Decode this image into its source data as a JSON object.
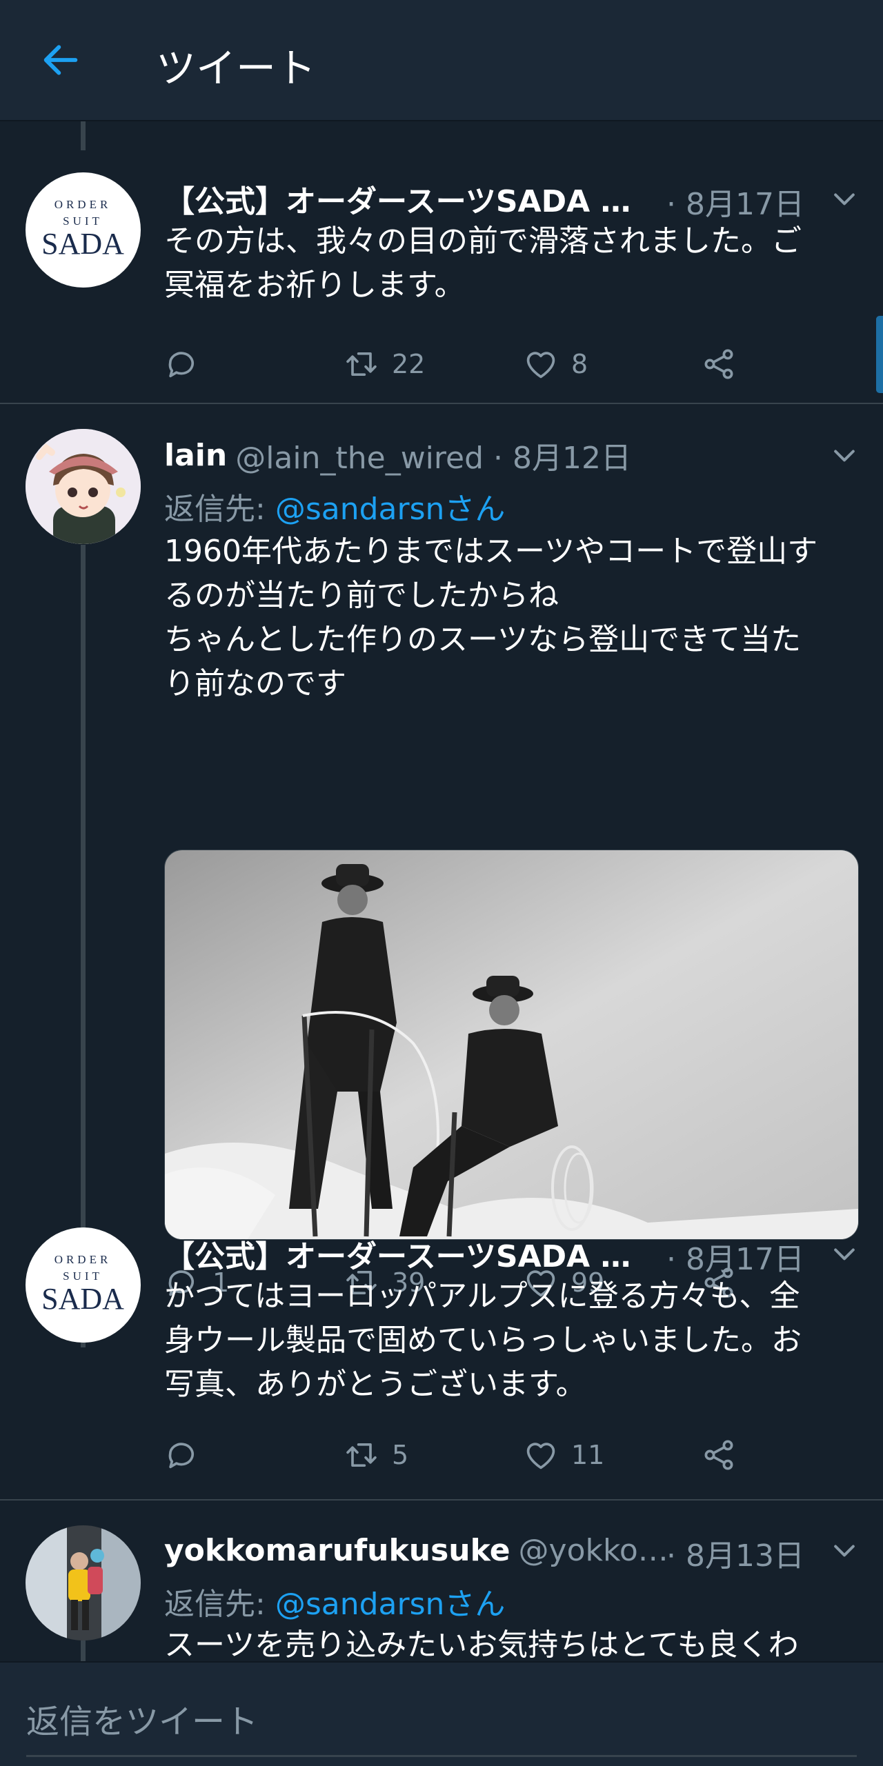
{
  "header": {
    "title": "ツイート"
  },
  "tweets": [
    {
      "name": "【公式】オーダースーツSADA …",
      "date": "· 8月17日",
      "avatar_text": [
        "ORDER",
        "SUIT",
        "SADA"
      ],
      "lines": [
        "その方は、我々の目の前で滑落されました。ご",
        "冥福をお祈りします。"
      ],
      "replies": "",
      "retweets": "22",
      "likes": "8"
    },
    {
      "name": "lain",
      "handle": "@lain_the_wired · 8月12日",
      "reply_label": "返信先: ",
      "reply_mention": "@sandarsnさん",
      "lines": [
        "1960年代あたりまではスーツやコートで登山す",
        "るのが当たり前でしたからね",
        "ちゃんとした作りのスーツなら登山できて当た",
        "り前なのです"
      ],
      "replies": "1",
      "retweets": "39",
      "likes": "99"
    },
    {
      "name": "【公式】オーダースーツSADA …",
      "date": "· 8月17日",
      "avatar_text": [
        "ORDER",
        "SUIT",
        "SADA"
      ],
      "lines": [
        "かつてはヨーロッパアルプスに登る方々も、全",
        "身ウール製品で固めていらっしゃいました。お",
        "写真、ありがとうございます。"
      ],
      "replies": "",
      "retweets": "5",
      "likes": "11"
    },
    {
      "name": "yokkomarufukusuke",
      "handle": "@yokko…",
      "date": "· 8月13日",
      "reply_label": "返信先: ",
      "reply_mention": "@sandarsnさん",
      "lines": [
        "スーツを売り込みたいお気持ちはとても良くわ"
      ]
    }
  ],
  "composer": {
    "placeholder": "返信をツイート"
  },
  "colors": {
    "background": "#15202b",
    "header": "#1b2836",
    "accent": "#1da1f2",
    "muted": "#8899a6",
    "divider": "#38444d"
  },
  "icons": [
    "back-arrow-icon",
    "chevron-down-icon",
    "reply-icon",
    "retweet-icon",
    "like-icon",
    "share-icon"
  ]
}
